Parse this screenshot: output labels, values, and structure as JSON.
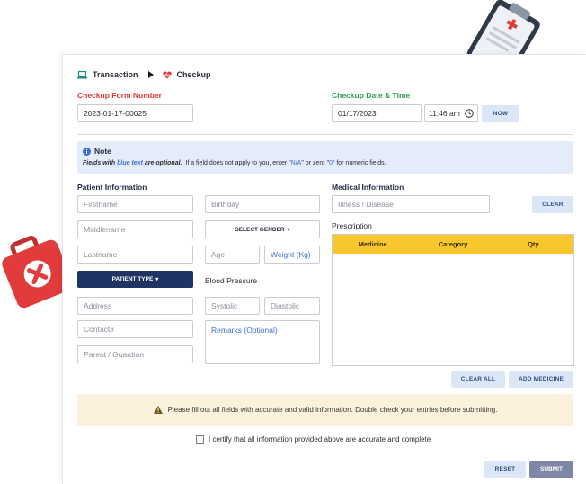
{
  "breadcrumb": {
    "first": "Transaction",
    "second": "Checkup"
  },
  "form_number": {
    "label": "Checkup Form Number",
    "value": "2023-01-17-00025"
  },
  "checkup_datetime": {
    "label": "Checkup Date & Time",
    "date": "01/17/2023",
    "time": "11:46 am",
    "now_label": "NOW"
  },
  "note": {
    "title": "Note",
    "part1": "Fields with ",
    "part2": "blue text",
    "part3": " are optional.",
    "part4": "  If a field does not apply to you, enter \"",
    "part5": "N/A",
    "part6": "\" or zero \"",
    "part7": "0",
    "part8": "\" for numeric fields."
  },
  "patient": {
    "heading": "Patient Information",
    "firstname": "Firstname",
    "birthday": "Birthday",
    "middlename": "Middlename",
    "gender_label": "SELECT GENDER",
    "lastname": "Lastname",
    "age": "Age",
    "weight": "Weight (Kg)",
    "patient_type_label": "PATIENT TYPE",
    "blood_pressure_label": "Blood Pressure",
    "address": "Address",
    "systolic": "Systolic",
    "diastolic": "Diastolic",
    "contact": "Contact#",
    "remarks": "Remarks (Optional)",
    "guardian": "Parent / Guardian"
  },
  "medical": {
    "heading": "Medical Information",
    "illness": "Illness / Disease",
    "clear_label": "CLEAR",
    "prescription_label": "Prescription",
    "columns": [
      "Medicine",
      "Category",
      "Qty"
    ],
    "clear_all_label": "CLEAR ALL",
    "add_medicine_label": "ADD MEDICINE"
  },
  "warning": {
    "text": "Please fill out all fields with accurate and valid information. Double check your entries before submitting."
  },
  "certify": {
    "text": "I certify that all information provided above are accurate and complete"
  },
  "actions": {
    "reset_label": "RESET",
    "submit_label": "SUBMIT"
  },
  "colors": {
    "accent_navy": "#1f3463",
    "header_yellow": "#f7c72b",
    "note_blue": "#e3ecf8",
    "warning_bg": "#fbf1dc",
    "red": "#d93a3a",
    "green": "#2e9a5a"
  }
}
